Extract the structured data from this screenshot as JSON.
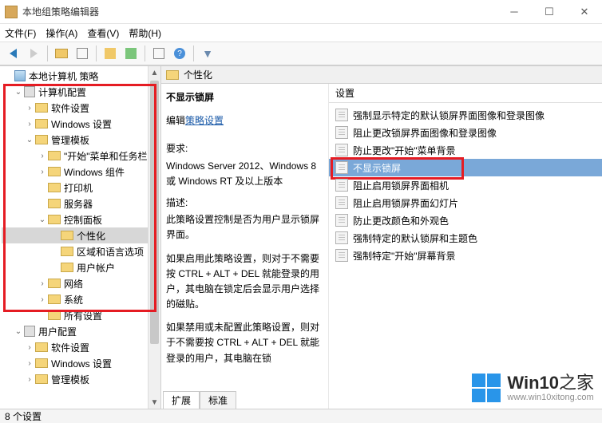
{
  "window": {
    "title": "本地组策略编辑器"
  },
  "menu": {
    "file": "文件(F)",
    "action": "操作(A)",
    "view": "查看(V)",
    "help": "帮助(H)"
  },
  "tree": {
    "root": "本地计算机 策略",
    "computer_cfg": "计算机配置",
    "soft_settings": "软件设置",
    "win_settings": "Windows 设置",
    "admin_templates": "管理模板",
    "start_taskbar": "\"开始\"菜单和任务栏",
    "win_components": "Windows 组件",
    "printers": "打印机",
    "server": "服务器",
    "control_panel": "控制面板",
    "personalization": "个性化",
    "region_lang": "区域和语言选项",
    "user_accounts": "用户帐户",
    "network": "网络",
    "system": "系统",
    "all_settings": "所有设置",
    "user_cfg": "用户配置",
    "u_soft_settings": "软件设置",
    "u_win_settings": "Windows 设置",
    "u_admin_templates": "管理模板"
  },
  "right_header": "个性化",
  "desc": {
    "title": "不显示锁屏",
    "edit_link_prefix": "编辑",
    "edit_link": "策略设置",
    "req_label": "要求:",
    "req_text": "Windows Server 2012、Windows 8 或 Windows RT 及以上版本",
    "desc_label": "描述:",
    "desc_text1": "此策略设置控制是否为用户显示锁屏界面。",
    "desc_text2": "如果启用此策略设置，则对于不需要按 CTRL + ALT + DEL 就能登录的用户，其电脑在锁定后会显示用户选择的磁贴。",
    "desc_text3": "如果禁用或未配置此策略设置，则对于不需要按 CTRL + ALT + DEL 就能登录的用户，其电脑在锁"
  },
  "settings_header": "设置",
  "settings": [
    "强制显示特定的默认锁屏界面图像和登录图像",
    "阻止更改锁屏界面图像和登录图像",
    "防止更改\"开始\"菜单背景",
    "不显示锁屏",
    "阻止启用锁屏界面相机",
    "阻止启用锁屏界面幻灯片",
    "防止更改颜色和外观色",
    "强制特定的默认锁屏和主题色",
    "强制特定\"开始\"屏幕背景"
  ],
  "tabs": {
    "extended": "扩展",
    "standard": "标准"
  },
  "status": "8 个设置",
  "watermark": {
    "brand": "Win10",
    "suffix": "之家",
    "url": "www.win10xitong.com"
  }
}
